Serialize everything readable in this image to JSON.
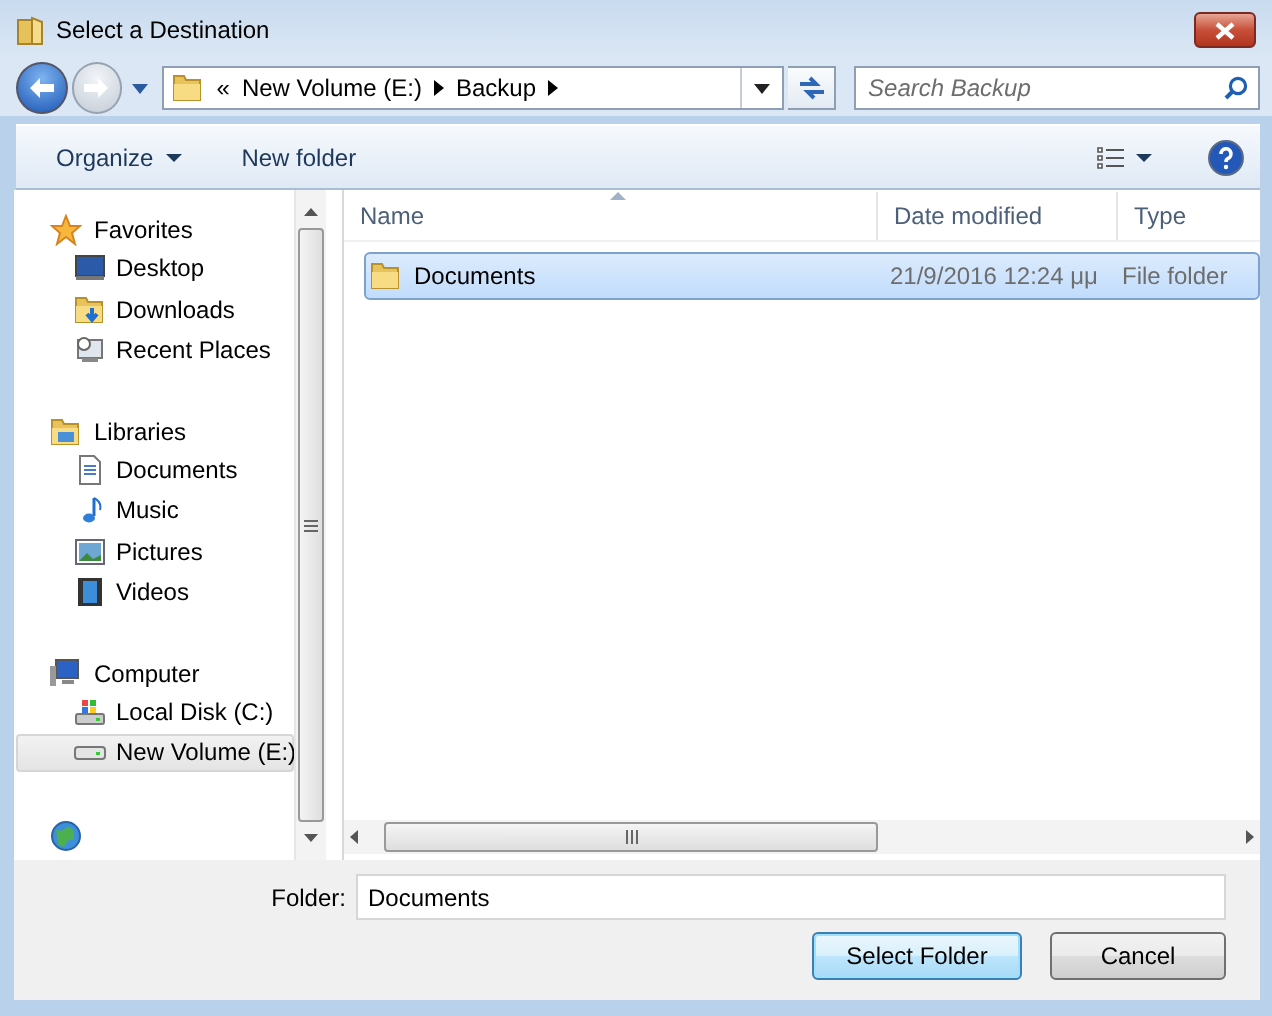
{
  "window": {
    "title": "Select a Destination"
  },
  "address_bar": {
    "overflow": "«",
    "path": [
      "New Volume (E:)",
      "Backup"
    ],
    "search_placeholder": "Search Backup"
  },
  "toolbar": {
    "organize": "Organize",
    "new_folder": "New folder"
  },
  "navigation": {
    "groups": [
      {
        "label": "Favorites",
        "kind": "star",
        "children": [
          {
            "label": "Desktop",
            "kind": "desktop",
            "selected": false
          },
          {
            "label": "Downloads",
            "kind": "downloads",
            "selected": false
          },
          {
            "label": "Recent Places",
            "kind": "recent",
            "selected": false
          }
        ]
      },
      {
        "label": "Libraries",
        "kind": "library",
        "children": [
          {
            "label": "Documents",
            "kind": "document",
            "selected": false
          },
          {
            "label": "Music",
            "kind": "music",
            "selected": false
          },
          {
            "label": "Pictures",
            "kind": "picture",
            "selected": false
          },
          {
            "label": "Videos",
            "kind": "video",
            "selected": false
          }
        ]
      },
      {
        "label": "Computer",
        "kind": "computer",
        "children": [
          {
            "label": "Local Disk (C:)",
            "kind": "sysdrive",
            "selected": false
          },
          {
            "label": "New Volume (E:)",
            "kind": "drive",
            "selected": true
          }
        ]
      }
    ]
  },
  "file_list": {
    "columns": [
      {
        "label": "Name",
        "sorted": true
      },
      {
        "label": "Date modified",
        "sorted": false
      },
      {
        "label": "Type",
        "sorted": false
      }
    ],
    "rows": [
      {
        "name": "Documents",
        "date": "21/9/2016 12:24 μμ",
        "type": "File folder",
        "selected": true
      }
    ]
  },
  "footer": {
    "folder_label": "Folder:",
    "folder_value": "Documents",
    "buttons": [
      {
        "label": "Select Folder",
        "default": true
      },
      {
        "label": "Cancel",
        "default": false
      }
    ]
  }
}
